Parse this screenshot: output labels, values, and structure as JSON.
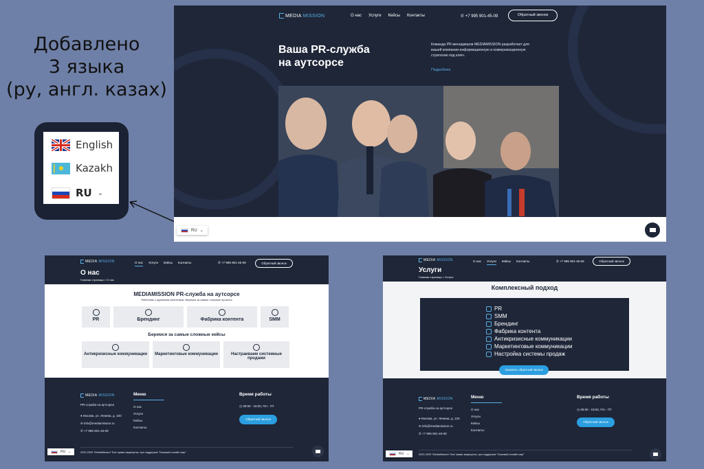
{
  "caption": {
    "line1": "Добавлено",
    "line2": "3 языка",
    "line3": "(ру, англ. казах)"
  },
  "lang_switcher": {
    "options": [
      "English",
      "Kazakh"
    ],
    "selected": "RU",
    "chevron": "chevron-down-icon"
  },
  "colors": {
    "page_bg": "#6f80a8",
    "dark": "#1e2638",
    "accent": "#5bb1e8",
    "button": "#2b9fe0"
  },
  "header": {
    "logo_part1": "MEDIA",
    "logo_part2": "MISSION",
    "nav": [
      "О нас",
      "Услуги",
      "Кейсы",
      "Контакты"
    ],
    "phone": "+7 995 901-45-09",
    "callback": "Обратный звонок"
  },
  "hero": {
    "title_line1": "Ваша PR-служба",
    "title_line2": "на аутсорсе",
    "description": "Команда PR-менеджеров MEDIAMISSION разработает для вашей компании информационную и коммуникационную стратегию под ключ.",
    "more": "Подробнее"
  },
  "lang_badge": "RU",
  "about": {
    "title": "О нас",
    "breadcrumb": "Главная страница > О нас",
    "heading": "MEDIAMISSION PR-служба на аутсорсе",
    "subheading": "Работаем с крупными клиентами, беремся за самые сложные проекты",
    "tiles": [
      "PR",
      "Брендинг",
      "Фабрика контента",
      "SMM"
    ],
    "heading2": "Беремся за самые сложные кейсы",
    "tiles2": [
      "Антикризисные коммуникации",
      "Маркетинговые коммуникации",
      "Настраиваем системные продажи"
    ]
  },
  "footer": {
    "tagline": "PR-служба на аутсорсе",
    "address": "Москва, ул. Ленина, д. 100",
    "email": "info@mediamission.ru",
    "phone": "+7 995 901-45-09",
    "menu_title": "Меню",
    "menu": [
      "О нас",
      "Услуги",
      "Кейсы",
      "Контакты"
    ],
    "hours_title": "Время работы",
    "hours": "09:00 - 18:00, ПН - ПТ",
    "callback": "Обратный звонок",
    "copyright": "2020-2025 \"MediaMission\" Все права защищены, при поддержке \"Базовый онлайн мир\""
  },
  "services": {
    "title": "Услуги",
    "breadcrumb": "Главная страница > Услуги",
    "heading": "Комплексный подход",
    "items": [
      "PR",
      "SMM",
      "Брендинг",
      "Фабрика контента",
      "Антикризисные коммуникации",
      "Маркетинговые коммуникации",
      "Настройка системы продаж"
    ],
    "cta": "Заказать обратный звонок"
  }
}
